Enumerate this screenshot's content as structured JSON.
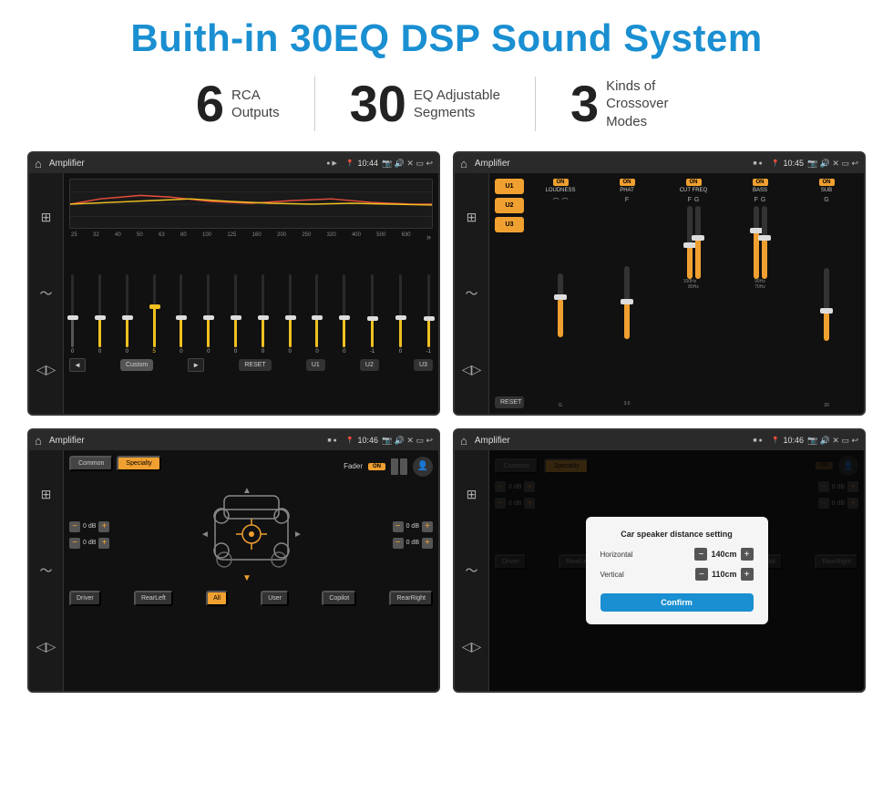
{
  "page": {
    "title": "Buith-in 30EQ DSP Sound System",
    "stats": [
      {
        "number": "6",
        "label": "RCA\nOutputs"
      },
      {
        "number": "30",
        "label": "EQ Adjustable\nSegments"
      },
      {
        "number": "3",
        "label": "Kinds of\nCrossover Modes"
      }
    ]
  },
  "screen1": {
    "statusbar": {
      "title": "Amplifier",
      "time": "10:44"
    },
    "freq_labels": [
      "25",
      "32",
      "40",
      "50",
      "63",
      "80",
      "100",
      "125",
      "160",
      "200",
      "250",
      "320",
      "400",
      "500",
      "630"
    ],
    "slider_values": [
      "0",
      "0",
      "0",
      "5",
      "0",
      "0",
      "0",
      "0",
      "0",
      "0",
      "0",
      "-1",
      "0",
      "-1"
    ],
    "buttons": [
      "Custom",
      "RESET",
      "U1",
      "U2",
      "U3"
    ]
  },
  "screen2": {
    "statusbar": {
      "title": "Amplifier",
      "time": "10:45"
    },
    "presets": [
      "U1",
      "U2",
      "U3"
    ],
    "channels": [
      {
        "name": "LOUDNESS",
        "on": true
      },
      {
        "name": "PHAT",
        "on": true
      },
      {
        "name": "CUT FREQ",
        "on": true
      },
      {
        "name": "BASS",
        "on": true
      },
      {
        "name": "SUB",
        "on": true
      }
    ],
    "reset_label": "RESET"
  },
  "screen3": {
    "statusbar": {
      "title": "Amplifier",
      "time": "10:46"
    },
    "tabs": [
      "Common",
      "Specialty"
    ],
    "active_tab": "Specialty",
    "fader_label": "Fader",
    "fader_on": "ON",
    "controls": {
      "top_left_db": "0 dB",
      "bottom_left_db": "0 dB",
      "top_right_db": "0 dB",
      "bottom_right_db": "0 dB"
    },
    "buttons": [
      "Driver",
      "RearLeft",
      "All",
      "User",
      "Copilot",
      "RearRight"
    ]
  },
  "screen4": {
    "statusbar": {
      "title": "Amplifier",
      "time": "10:46"
    },
    "tabs": [
      "Common",
      "Specialty"
    ],
    "dialog": {
      "title": "Car speaker distance setting",
      "horizontal_label": "Horizontal",
      "horizontal_value": "140cm",
      "vertical_label": "Vertical",
      "vertical_value": "110cm",
      "confirm_label": "Confirm"
    },
    "controls": {
      "top_right_db": "0 dB",
      "bottom_right_db": "0 dB"
    },
    "buttons": [
      "Driver",
      "RearLef...",
      "All",
      "User",
      "Copilot",
      "RearRight"
    ]
  }
}
